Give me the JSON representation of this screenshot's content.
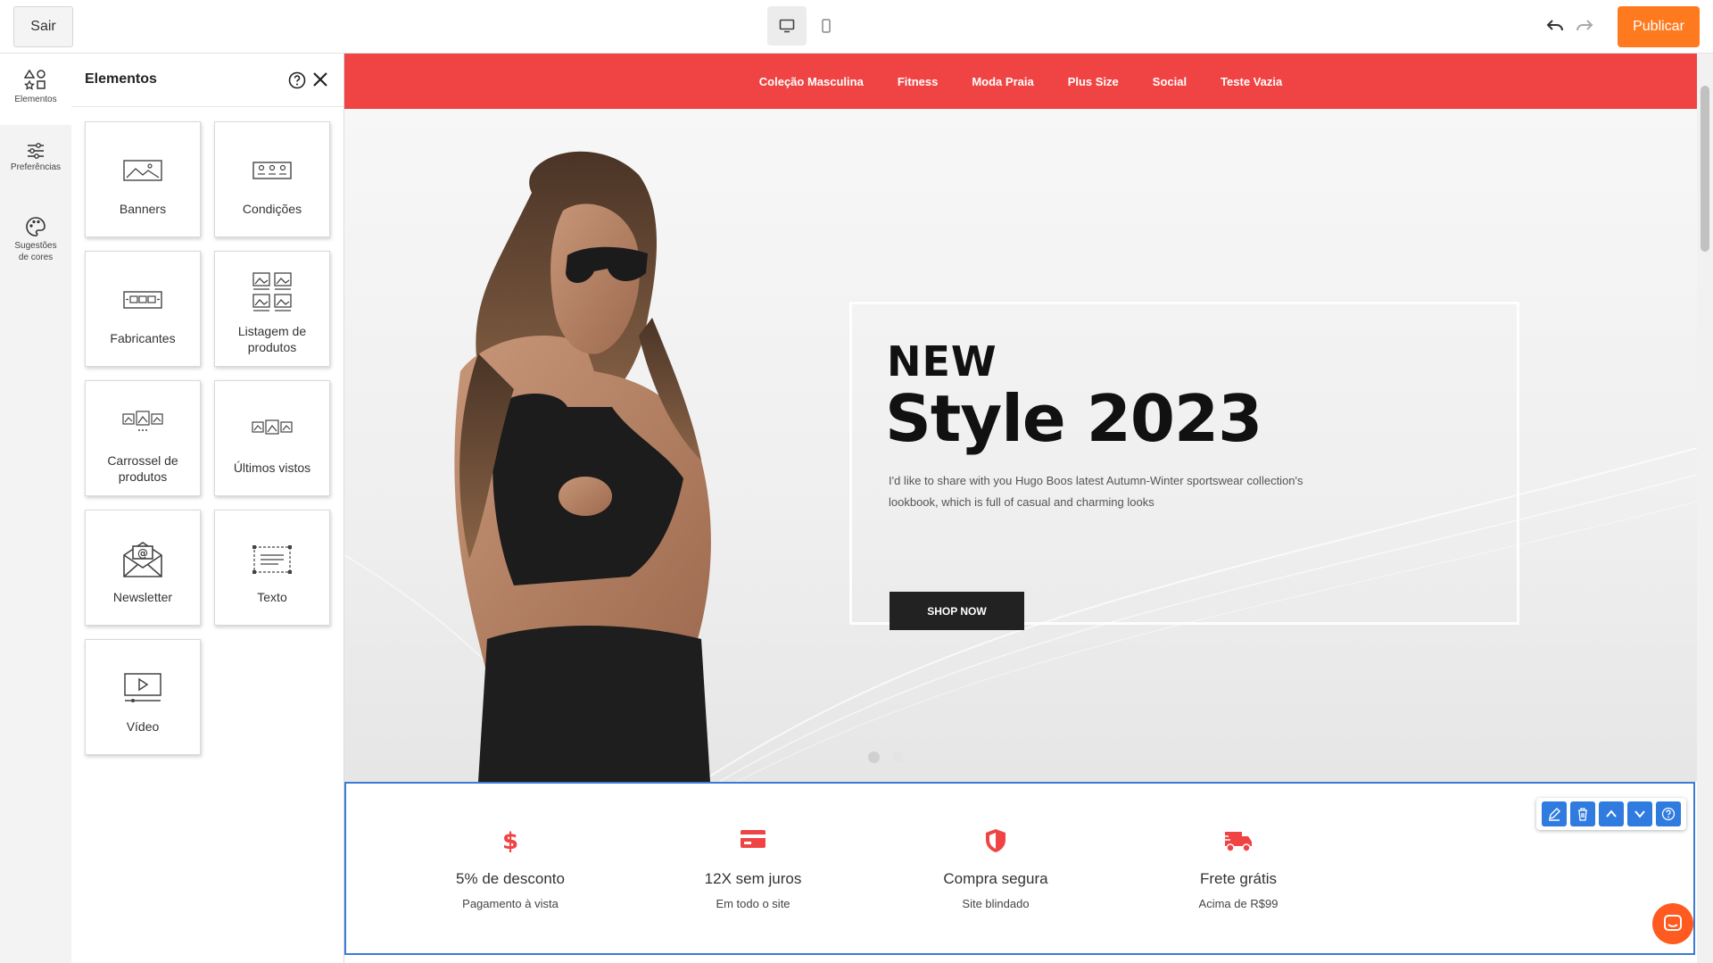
{
  "topbar": {
    "exit_label": "Sair",
    "publish_label": "Publicar",
    "device_desktop_icon": "desktop-icon",
    "device_mobile_icon": "mobile-icon"
  },
  "rail": {
    "items": [
      {
        "label": "Elementos",
        "icon": "shapes-icon"
      },
      {
        "label": "Preferências",
        "icon": "sliders-icon"
      },
      {
        "label_line1": "Sugestões",
        "label_line2": "de cores",
        "icon": "palette-icon"
      }
    ]
  },
  "panel": {
    "title": "Elementos",
    "tiles": [
      {
        "label": "Banners"
      },
      {
        "label": "Condições"
      },
      {
        "label": "Fabricantes"
      },
      {
        "label_line1": "Listagem de",
        "label_line2": "produtos"
      },
      {
        "label_line1": "Carrossel de",
        "label_line2": "produtos"
      },
      {
        "label": "Últimos vistos"
      },
      {
        "label": "Newsletter"
      },
      {
        "label": "Texto"
      },
      {
        "label": "Vídeo"
      }
    ]
  },
  "store": {
    "nav": [
      "Coleção Masculina",
      "Fitness",
      "Moda Praia",
      "Plus Size",
      "Social",
      "Teste Vazia"
    ],
    "hero": {
      "kicker": "NEW",
      "title": "Style 2023",
      "text": "I'd like to share with you Hugo Boos latest Autumn-Winter sportswear collection's lookbook, which is full of casual and charming looks",
      "button": "SHOP NOW"
    },
    "features": [
      {
        "title": "5% de desconto",
        "subtitle": "Pagamento à vista",
        "icon": "dollar-icon"
      },
      {
        "title": "12X sem juros",
        "subtitle": "Em todo o site",
        "icon": "credit-card-icon"
      },
      {
        "title": "Compra segura",
        "subtitle": "Site blindado",
        "icon": "shield-icon"
      },
      {
        "title": "Frete grátis",
        "subtitle": "Acima de R$99",
        "icon": "truck-icon"
      }
    ]
  },
  "colors": {
    "accent": "#ff7a1f",
    "nav_bg": "#f04444",
    "selection": "#2f7be0"
  }
}
